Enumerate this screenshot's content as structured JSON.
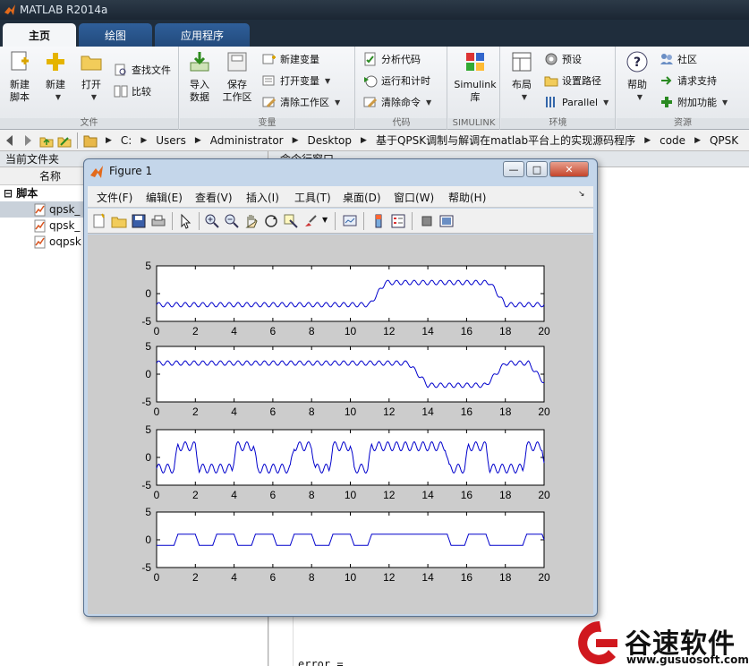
{
  "app": {
    "title": "MATLAB R2014a"
  },
  "tabs": [
    {
      "label": "主页"
    },
    {
      "label": "绘图"
    },
    {
      "label": "应用程序"
    }
  ],
  "ribbon": {
    "file": {
      "label": "文件",
      "new_script": "新建\n脚本",
      "new": "新建",
      "open": "打开",
      "find_files": "查找文件",
      "compare": "比较"
    },
    "variable": {
      "label": "变量",
      "import": "导入\n数据",
      "save_ws": "保存\n工作区",
      "new_var": "新建变量",
      "open_var": "打开变量",
      "clear_ws": "清除工作区"
    },
    "code": {
      "label": "代码",
      "analyze": "分析代码",
      "run_time": "运行和计时",
      "clear_cmd": "清除命令"
    },
    "simulink": {
      "label": "SIMULINK",
      "lib": "Simulink\n库"
    },
    "env": {
      "label": "环境",
      "layout": "布局",
      "prefs": "预设",
      "set_path": "设置路径",
      "parallel": "Parallel"
    },
    "resources": {
      "label": "资源",
      "help": "帮助",
      "community": "社区",
      "support": "请求支持",
      "addons": "附加功能"
    }
  },
  "address": {
    "segments": [
      "C:",
      "Users",
      "Administrator",
      "Desktop",
      "基于QPSK调制与解调在matlab平台上的实现源码程序",
      "code",
      "QPSK"
    ]
  },
  "left_panel": {
    "title": "当前文件夹",
    "col_name": "名称",
    "group": "脚本",
    "files": [
      "qpsk_",
      "qpsk_",
      "oqpsk"
    ]
  },
  "right_panel": {
    "title": "命令行窗口",
    "cmd_text": "error ="
  },
  "figure": {
    "title": "Figure 1",
    "menu": [
      "文件(F)",
      "编辑(E)",
      "查看(V)",
      "插入(I)",
      "工具(T)",
      "桌面(D)",
      "窗口(W)",
      "帮助(H)"
    ]
  },
  "chart_data": [
    {
      "type": "line",
      "title": "",
      "xlim": [
        0,
        20
      ],
      "ylim": [
        -5,
        5
      ],
      "xticks": [
        0,
        2,
        4,
        6,
        8,
        10,
        12,
        14,
        16,
        18,
        20
      ],
      "yticks": [
        5,
        0,
        -5
      ],
      "color": "#0000cc",
      "segments": [
        [
          0,
          -2
        ],
        [
          11,
          -2
        ],
        [
          11.8,
          2
        ],
        [
          17.2,
          2
        ],
        [
          18,
          -2
        ],
        [
          20,
          -2
        ]
      ],
      "ripple": 0.4
    },
    {
      "type": "line",
      "title": "",
      "xlim": [
        0,
        20
      ],
      "ylim": [
        -5,
        5
      ],
      "xticks": [
        0,
        2,
        4,
        6,
        8,
        10,
        12,
        14,
        16,
        18,
        20
      ],
      "yticks": [
        5,
        0,
        -5
      ],
      "color": "#0000cc",
      "segments": [
        [
          0,
          2
        ],
        [
          13,
          2
        ],
        [
          14,
          -2
        ],
        [
          17,
          -2
        ],
        [
          18,
          2
        ],
        [
          19.2,
          2
        ],
        [
          20,
          -1.5
        ]
      ],
      "ripple": 0.4
    },
    {
      "type": "line",
      "title": "",
      "xlim": [
        0,
        20
      ],
      "ylim": [
        -5,
        5
      ],
      "xticks": [
        0,
        2,
        4,
        6,
        8,
        10,
        12,
        14,
        16,
        18,
        20
      ],
      "yticks": [
        5,
        0,
        -5
      ],
      "color": "#0000cc",
      "segments": [
        [
          0,
          -2
        ],
        [
          0.9,
          -2
        ],
        [
          1.1,
          2
        ],
        [
          2,
          2
        ],
        [
          2.2,
          -2
        ],
        [
          3.9,
          -2
        ],
        [
          4.1,
          2
        ],
        [
          5,
          2
        ],
        [
          5.2,
          -2
        ],
        [
          6.9,
          -2
        ],
        [
          7.1,
          2
        ],
        [
          8,
          2
        ],
        [
          8.2,
          -2
        ],
        [
          8.9,
          -2
        ],
        [
          9.1,
          2
        ],
        [
          10,
          2
        ],
        [
          10.2,
          -2
        ],
        [
          10.9,
          -2
        ],
        [
          11.1,
          2
        ],
        [
          14.9,
          2
        ],
        [
          15.1,
          -2
        ],
        [
          15.9,
          -2
        ],
        [
          16.1,
          2
        ],
        [
          17,
          2
        ],
        [
          17.2,
          -2
        ],
        [
          18.9,
          -2
        ],
        [
          19.1,
          2
        ],
        [
          19.9,
          2
        ],
        [
          20,
          -1
        ]
      ],
      "ripple": 0.8
    },
    {
      "type": "line",
      "title": "",
      "xlim": [
        0,
        20
      ],
      "ylim": [
        -5,
        5
      ],
      "xticks": [
        0,
        2,
        4,
        6,
        8,
        10,
        12,
        14,
        16,
        18,
        20
      ],
      "yticks": [
        5,
        0,
        -5
      ],
      "color": "#0000cc",
      "segments": [
        [
          0,
          -1
        ],
        [
          0.9,
          -1
        ],
        [
          1.1,
          1
        ],
        [
          2,
          1
        ],
        [
          2.2,
          -1
        ],
        [
          2.9,
          -1
        ],
        [
          3.1,
          1
        ],
        [
          4,
          1
        ],
        [
          4.2,
          -1
        ],
        [
          4.9,
          -1
        ],
        [
          5.1,
          1
        ],
        [
          6,
          1
        ],
        [
          6.2,
          -1
        ],
        [
          6.9,
          -1
        ],
        [
          7.1,
          1
        ],
        [
          8,
          1
        ],
        [
          8.2,
          -1
        ],
        [
          8.9,
          -1
        ],
        [
          9.1,
          1
        ],
        [
          10,
          1
        ],
        [
          10.2,
          -1
        ],
        [
          10.9,
          -1
        ],
        [
          11.1,
          1
        ],
        [
          15,
          1
        ],
        [
          15.2,
          -1
        ],
        [
          15.9,
          -1
        ],
        [
          16.1,
          1
        ],
        [
          17,
          1
        ],
        [
          17.2,
          -1
        ],
        [
          18.9,
          -1
        ],
        [
          19.1,
          1
        ],
        [
          19.9,
          1
        ],
        [
          20,
          0
        ]
      ],
      "ripple": 0
    }
  ],
  "watermark": {
    "text": "谷速软件",
    "url": "www.gusuosoft.com"
  }
}
